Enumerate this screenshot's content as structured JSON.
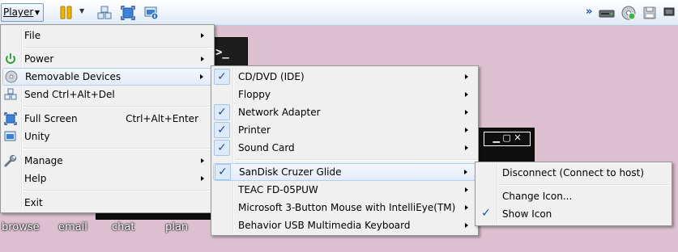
{
  "toolbar": {
    "player_label": "Player",
    "icons": [
      "pause-icon",
      "send-ctrl-alt-del-icon",
      "full-screen-icon",
      "unity-icon"
    ],
    "right_icons": [
      "overflow-chevron-icon",
      "hard-disk-icon",
      "cd-dvd-icon",
      "floppy-icon",
      "network-icon"
    ]
  },
  "desktop": {
    "icons": [
      "browse",
      "email",
      "chat",
      "plan"
    ]
  },
  "player_menu": {
    "items": [
      {
        "label": "File"
      },
      {
        "label": "Power"
      },
      {
        "label": "Removable Devices"
      },
      {
        "label": "Send Ctrl+Alt+Del"
      },
      {
        "label": "Full Screen",
        "accelerator": "Ctrl+Alt+Enter"
      },
      {
        "label": "Unity"
      },
      {
        "label": "Manage"
      },
      {
        "label": "Help"
      },
      {
        "label": "Exit"
      }
    ]
  },
  "removable_menu": {
    "items": [
      {
        "label": "CD/DVD (IDE)",
        "checked": true
      },
      {
        "label": "Floppy",
        "checked": false
      },
      {
        "label": "Network Adapter",
        "checked": true
      },
      {
        "label": "Printer",
        "checked": true
      },
      {
        "label": "Sound Card",
        "checked": true
      },
      {
        "label": "SanDisk Cruzer Glide",
        "checked": true
      },
      {
        "label": "TEAC FD-05PUW",
        "checked": false
      },
      {
        "label": "Microsoft 3-Button Mouse with IntelliEye(TM)",
        "checked": false
      },
      {
        "label": "Behavior USB Multimedia Keyboard",
        "checked": false
      }
    ]
  },
  "device_menu": {
    "items": [
      {
        "label": "Disconnect (Connect to host)"
      },
      {
        "label": "Change Icon..."
      },
      {
        "label": "Show Icon",
        "checked": true
      }
    ]
  },
  "check_glyph": "✓",
  "colors": {
    "desktop_background": "#dcc0cf",
    "menu_background": "#f0f0f0",
    "highlight_border": "#aecff7"
  }
}
